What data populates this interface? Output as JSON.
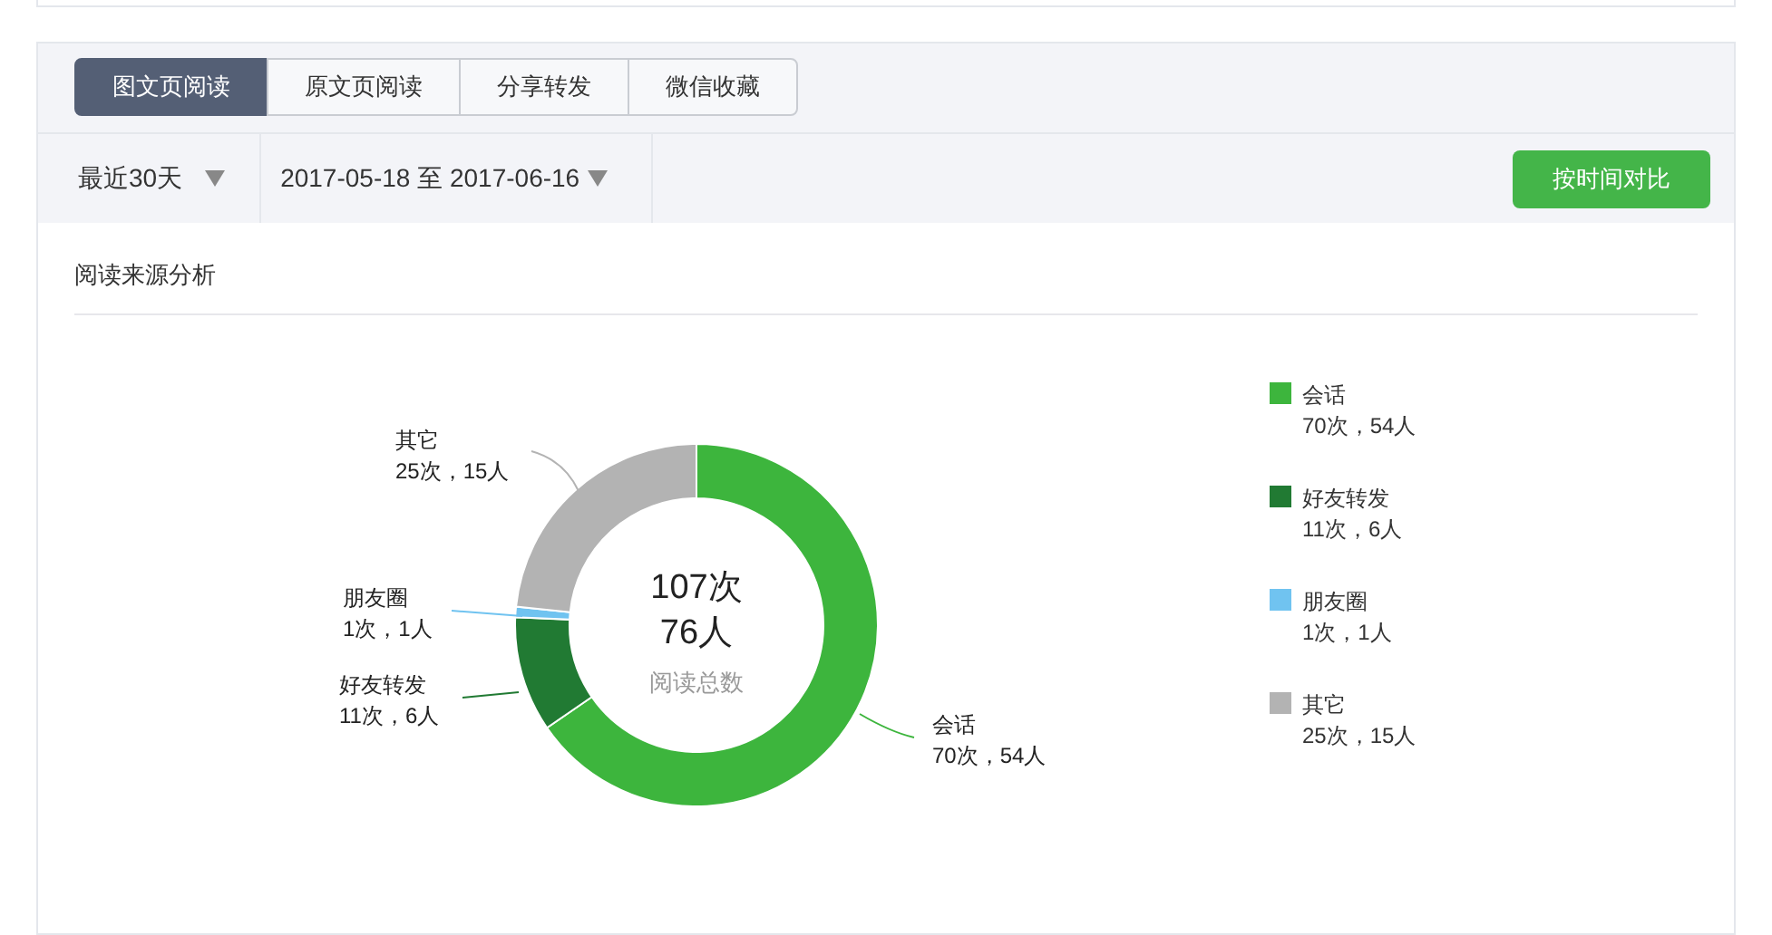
{
  "tabs": [
    {
      "label": "图文页阅读",
      "selected": true
    },
    {
      "label": "原文页阅读",
      "selected": false
    },
    {
      "label": "分享转发",
      "selected": false
    },
    {
      "label": "微信收藏",
      "selected": false
    }
  ],
  "filters": {
    "period": "最近30天",
    "date_range": "2017-05-18 至 2017-06-16",
    "compare_button": "按时间对比"
  },
  "section_title": "阅读来源分析",
  "chart_data": {
    "type": "donut",
    "categories": [
      "会话",
      "好友转发",
      "朋友圈",
      "其它"
    ],
    "values": [
      70,
      11,
      1,
      25
    ],
    "value_labels": [
      "70次，54人",
      "11次，6人",
      "1次，1人",
      "25次，15人"
    ]
  },
  "total": {
    "reads": "107次",
    "people": "76人",
    "label": "阅读总数"
  },
  "legend": [
    {
      "name": "会话",
      "detail": "70次，54人",
      "color": "#3db53d"
    },
    {
      "name": "好友转发",
      "detail": "11次，6人",
      "color": "#217a33"
    },
    {
      "name": "朋友圈",
      "detail": "1次，1人",
      "color": "#70c3f0"
    },
    {
      "name": "其它",
      "detail": "25次，15人",
      "color": "#b3b3b3"
    }
  ]
}
